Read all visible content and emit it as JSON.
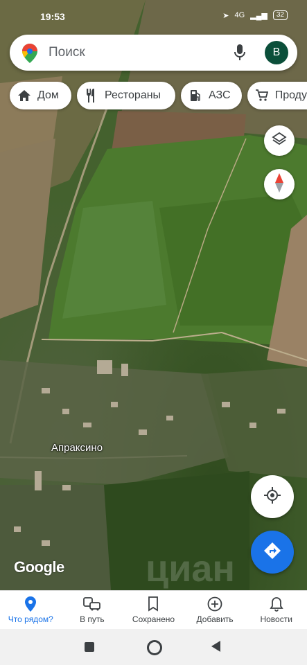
{
  "status": {
    "time": "19:53",
    "network": "4G",
    "battery": "32"
  },
  "search": {
    "placeholder": "Поиск",
    "avatar_letter": "B"
  },
  "chips": [
    {
      "label": "Дом",
      "icon": "home-icon"
    },
    {
      "label": "Рестораны",
      "icon": "restaurant-icon"
    },
    {
      "label": "АЗС",
      "icon": "gas-station-icon"
    },
    {
      "label": "Проду",
      "icon": "shopping-cart-icon"
    }
  ],
  "map": {
    "place_label": "Апраксино",
    "attribution": "Google",
    "watermark": "циан"
  },
  "bottom_nav": [
    {
      "label": "Что рядом?",
      "icon": "location-pin-icon",
      "active": true
    },
    {
      "label": "В путь",
      "icon": "commute-icon",
      "active": false
    },
    {
      "label": "Сохранено",
      "icon": "bookmark-icon",
      "active": false
    },
    {
      "label": "Добавить",
      "icon": "add-circle-icon",
      "active": false
    },
    {
      "label": "Новости",
      "icon": "bell-icon",
      "active": false
    }
  ],
  "colors": {
    "accent": "#1a73e8",
    "avatar": "#0b4f3a"
  }
}
